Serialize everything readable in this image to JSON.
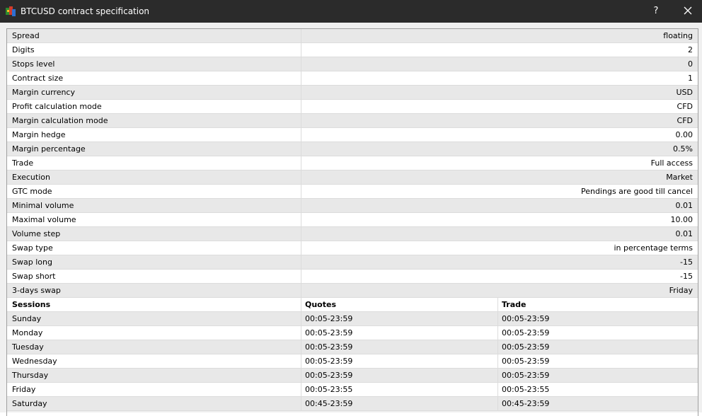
{
  "window": {
    "title": "BTCUSD contract specification",
    "help_label": "?"
  },
  "specs": [
    {
      "name": "Spread",
      "value": "floating"
    },
    {
      "name": "Digits",
      "value": "2"
    },
    {
      "name": "Stops level",
      "value": "0"
    },
    {
      "name": "Contract size",
      "value": "1"
    },
    {
      "name": "Margin currency",
      "value": "USD"
    },
    {
      "name": "Profit calculation mode",
      "value": "CFD"
    },
    {
      "name": "Margin calculation mode",
      "value": "CFD"
    },
    {
      "name": "Margin hedge",
      "value": "0.00"
    },
    {
      "name": "Margin percentage",
      "value": "0.5%"
    },
    {
      "name": "Trade",
      "value": "Full access"
    },
    {
      "name": "Execution",
      "value": "Market"
    },
    {
      "name": "GTC mode",
      "value": "Pendings are good till cancel"
    },
    {
      "name": "Minimal volume",
      "value": "0.01"
    },
    {
      "name": "Maximal volume",
      "value": "10.00"
    },
    {
      "name": "Volume step",
      "value": "0.01"
    },
    {
      "name": "Swap type",
      "value": "in percentage terms"
    },
    {
      "name": "Swap long",
      "value": "-15"
    },
    {
      "name": "Swap short",
      "value": "-15"
    },
    {
      "name": "3-days swap",
      "value": "Friday"
    }
  ],
  "sessions": {
    "headers": {
      "day": "Sessions",
      "quotes": "Quotes",
      "trade": "Trade"
    },
    "rows": [
      {
        "day": "Sunday",
        "quotes": "00:05-23:59",
        "trade": "00:05-23:59"
      },
      {
        "day": "Monday",
        "quotes": "00:05-23:59",
        "trade": "00:05-23:59"
      },
      {
        "day": "Tuesday",
        "quotes": "00:05-23:59",
        "trade": "00:05-23:59"
      },
      {
        "day": "Wednesday",
        "quotes": "00:05-23:59",
        "trade": "00:05-23:59"
      },
      {
        "day": "Thursday",
        "quotes": "00:05-23:59",
        "trade": "00:05-23:59"
      },
      {
        "day": "Friday",
        "quotes": "00:05-23:55",
        "trade": "00:05-23:55"
      },
      {
        "day": "Saturday",
        "quotes": "00:45-23:59",
        "trade": "00:45-23:59"
      }
    ]
  }
}
